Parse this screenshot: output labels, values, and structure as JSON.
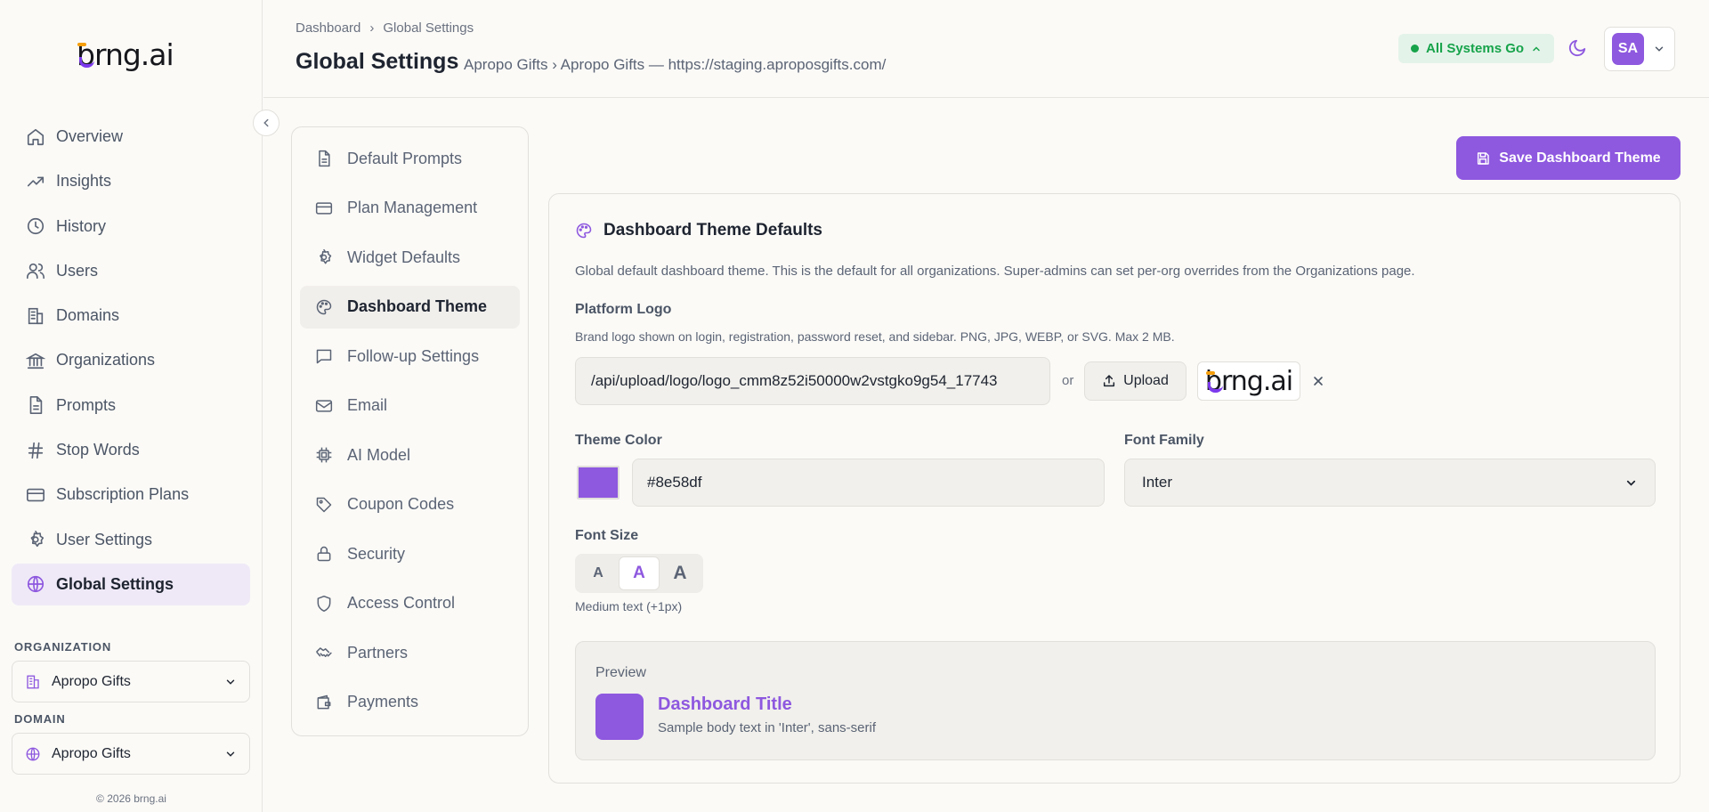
{
  "brand": {
    "logo_text": "brng.ai",
    "accent": "#8e58df"
  },
  "sidebar": {
    "items": [
      {
        "label": "Overview",
        "icon": "home-icon"
      },
      {
        "label": "Insights",
        "icon": "trending-up-icon"
      },
      {
        "label": "History",
        "icon": "clock-icon"
      },
      {
        "label": "Users",
        "icon": "users-icon"
      },
      {
        "label": "Domains",
        "icon": "building-icon"
      },
      {
        "label": "Organizations",
        "icon": "bank-icon"
      },
      {
        "label": "Prompts",
        "icon": "document-icon"
      },
      {
        "label": "Stop Words",
        "icon": "hash-icon"
      },
      {
        "label": "Subscription Plans",
        "icon": "credit-card-icon"
      },
      {
        "label": "User Settings",
        "icon": "gear-icon"
      },
      {
        "label": "Global Settings",
        "icon": "globe-icon",
        "active": true
      }
    ],
    "organization_label": "ORGANIZATION",
    "organization_value": "Apropo Gifts",
    "domain_label": "DOMAIN",
    "domain_value": "Apropo Gifts",
    "copyright": "© 2026 brng.ai"
  },
  "header": {
    "breadcrumb": [
      "Dashboard",
      "Global Settings"
    ],
    "breadcrumb_sep": "›",
    "title": "Global Settings",
    "subtitle": "Apropo Gifts › Apropo Gifts — https://staging.aproposgifts.com/",
    "status": "All Systems Go",
    "status_color": "#16a34a",
    "avatar_initials": "SA"
  },
  "settings_nav": [
    {
      "label": "Default Prompts",
      "icon": "document-icon"
    },
    {
      "label": "Plan Management",
      "icon": "credit-card-icon"
    },
    {
      "label": "Widget Defaults",
      "icon": "gear-icon"
    },
    {
      "label": "Dashboard Theme",
      "icon": "palette-icon",
      "active": true
    },
    {
      "label": "Follow-up Settings",
      "icon": "message-square-icon"
    },
    {
      "label": "Email",
      "icon": "mail-icon"
    },
    {
      "label": "AI Model",
      "icon": "cpu-icon"
    },
    {
      "label": "Coupon Codes",
      "icon": "tag-icon"
    },
    {
      "label": "Security",
      "icon": "lock-icon"
    },
    {
      "label": "Access Control",
      "icon": "shield-icon"
    },
    {
      "label": "Partners",
      "icon": "handshake-icon"
    },
    {
      "label": "Payments",
      "icon": "wallet-icon"
    }
  ],
  "main": {
    "save_label": "Save Dashboard Theme",
    "card_title": "Dashboard Theme Defaults",
    "description": "Global default dashboard theme. This is the default for all organizations. Super-admins can set per-org overrides from the Organizations page.",
    "platform_logo_label": "Platform Logo",
    "platform_logo_hint": "Brand logo shown on login, registration, password reset, and sidebar. PNG, JPG, WEBP, or SVG. Max 2 MB.",
    "logo_url": "/api/upload/logo/logo_cmm8z52i50000w2vstgko9g54_17743",
    "or_text": "or",
    "upload_label": "Upload",
    "theme_color_label": "Theme Color",
    "theme_color_value": "#8e58df",
    "font_family_label": "Font Family",
    "font_family_value": "Inter",
    "font_size_label": "Font Size",
    "font_size_options": [
      "A",
      "A",
      "A"
    ],
    "font_size_selected": 1,
    "font_size_hint": "Medium text (+1px)",
    "preview_label": "Preview",
    "preview_title": "Dashboard Title",
    "preview_body": "Sample body text in 'Inter', sans-serif"
  }
}
